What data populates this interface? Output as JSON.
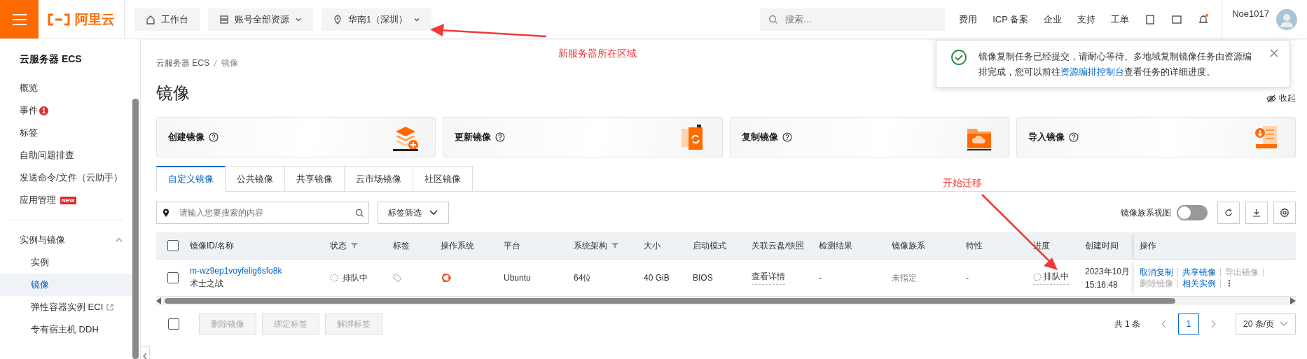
{
  "topbar": {
    "logo": "阿里云",
    "nav_buttons": [
      {
        "kind": "home",
        "label": "工作台",
        "dropdown": false
      },
      {
        "kind": "server",
        "label": "账号全部资源",
        "dropdown": true
      },
      {
        "kind": "pin",
        "label": "华南1（深圳）",
        "dropdown": true
      }
    ],
    "search": {
      "placeholder": "搜索..."
    },
    "links": [
      "费用",
      "ICP 备案",
      "企业",
      "支持",
      "工单"
    ],
    "user": "Noe1017"
  },
  "annotations": [
    {
      "text": "新服务器所在区域"
    },
    {
      "text": "开始迁移"
    }
  ],
  "toast": {
    "before": "镜像复制任务已经提交，请耐心等待。多地域复制镜像任务由资源编排完成，您可以前往",
    "link": "资源编排控制台",
    "after": "查看任务的详细进度。"
  },
  "sidebar": {
    "title": "云服务器 ECS",
    "items": [
      {
        "label": "概览"
      },
      {
        "label": "事件",
        "badge": "1"
      },
      {
        "label": "标签"
      },
      {
        "label": "自助问题排查"
      },
      {
        "label": "发送命令/文件（云助手）"
      },
      {
        "label": "应用管理",
        "tag": "NEW"
      }
    ],
    "groups": [
      {
        "label": "实例与镜像",
        "expanded": true,
        "children": [
          {
            "label": "实例",
            "selected": false,
            "external": false
          },
          {
            "label": "镜像",
            "selected": true,
            "external": false
          },
          {
            "label": "弹性容器实例 ECI",
            "selected": false,
            "external": true
          },
          {
            "label": "专有宿主机 DDH",
            "selected": false,
            "external": false
          }
        ]
      }
    ]
  },
  "breadcrumb": [
    "云服务器 ECS",
    "镜像"
  ],
  "page_title": "镜像",
  "collapse_label": "收起",
  "cards": [
    {
      "kind": "create",
      "label": "创建镜像"
    },
    {
      "kind": "update",
      "label": "更新镜像"
    },
    {
      "kind": "copy",
      "label": "复制镜像"
    },
    {
      "kind": "import",
      "label": "导入镜像"
    }
  ],
  "tabs": [
    {
      "label": "自定义镜像",
      "selected": true
    },
    {
      "label": "公共镜像",
      "selected": false
    },
    {
      "label": "共享镜像",
      "selected": false
    },
    {
      "label": "云市场镜像",
      "selected": false
    },
    {
      "label": "社区镜像",
      "selected": false
    }
  ],
  "toolbar": {
    "search": {
      "placeholder": "请输入您要搜索的内容"
    },
    "tag_filter": "标签筛选",
    "family_view": {
      "label": "镜像族系视图",
      "on": false
    }
  },
  "table": {
    "header_checked": false,
    "columns": [
      {
        "label": "镜像ID/名称",
        "filter": false
      },
      {
        "label": "状态",
        "filter": true
      },
      {
        "label": "标签",
        "filter": false
      },
      {
        "label": "操作系统",
        "filter": false
      },
      {
        "label": "平台",
        "filter": false
      },
      {
        "label": "系统架构",
        "filter": true
      },
      {
        "label": "大小",
        "filter": false
      },
      {
        "label": "启动模式",
        "filter": false
      },
      {
        "label": "关联云盘/快照",
        "filter": false
      },
      {
        "label": "检测结果",
        "filter": false
      },
      {
        "label": "镜像族系",
        "filter": false
      },
      {
        "label": "特性",
        "filter": false
      },
      {
        "label": "进度",
        "filter": false
      },
      {
        "label": "创建时间",
        "filter": false
      },
      {
        "label": "操作",
        "filter": false
      }
    ],
    "rows": [
      {
        "checked": false,
        "id": "m-wz9ep1voyfelig6sfo8k",
        "name": "术士之战",
        "status": "排队中",
        "platform": "Ubuntu",
        "arch": "64位",
        "size": "40 GiB",
        "boot": "BIOS",
        "disk": "查看详情",
        "check": "-",
        "family": "未指定",
        "feature": "-",
        "progress": "排队中",
        "created_date": "2023年10月",
        "created_time": "15:16:48",
        "actions": [
          {
            "label": "取消复制",
            "disabled": false
          },
          {
            "label": "共享镜像",
            "disabled": false
          },
          {
            "label": "导出镜像",
            "disabled": true
          },
          {
            "label": "删除镜像",
            "disabled": true
          },
          {
            "label": "相关实例",
            "disabled": false
          },
          {
            "label": "⋮",
            "disabled": false
          }
        ]
      }
    ]
  },
  "footer": {
    "checked": false,
    "buttons": [
      {
        "label": "删除镜像",
        "disabled": true
      },
      {
        "label": "绑定标签",
        "disabled": true
      },
      {
        "label": "解绑标签",
        "disabled": true
      }
    ]
  },
  "pagination": {
    "total": "共 1 条",
    "pages": [
      {
        "label": "1",
        "selected": true
      }
    ],
    "page_size": "20 条/页"
  }
}
